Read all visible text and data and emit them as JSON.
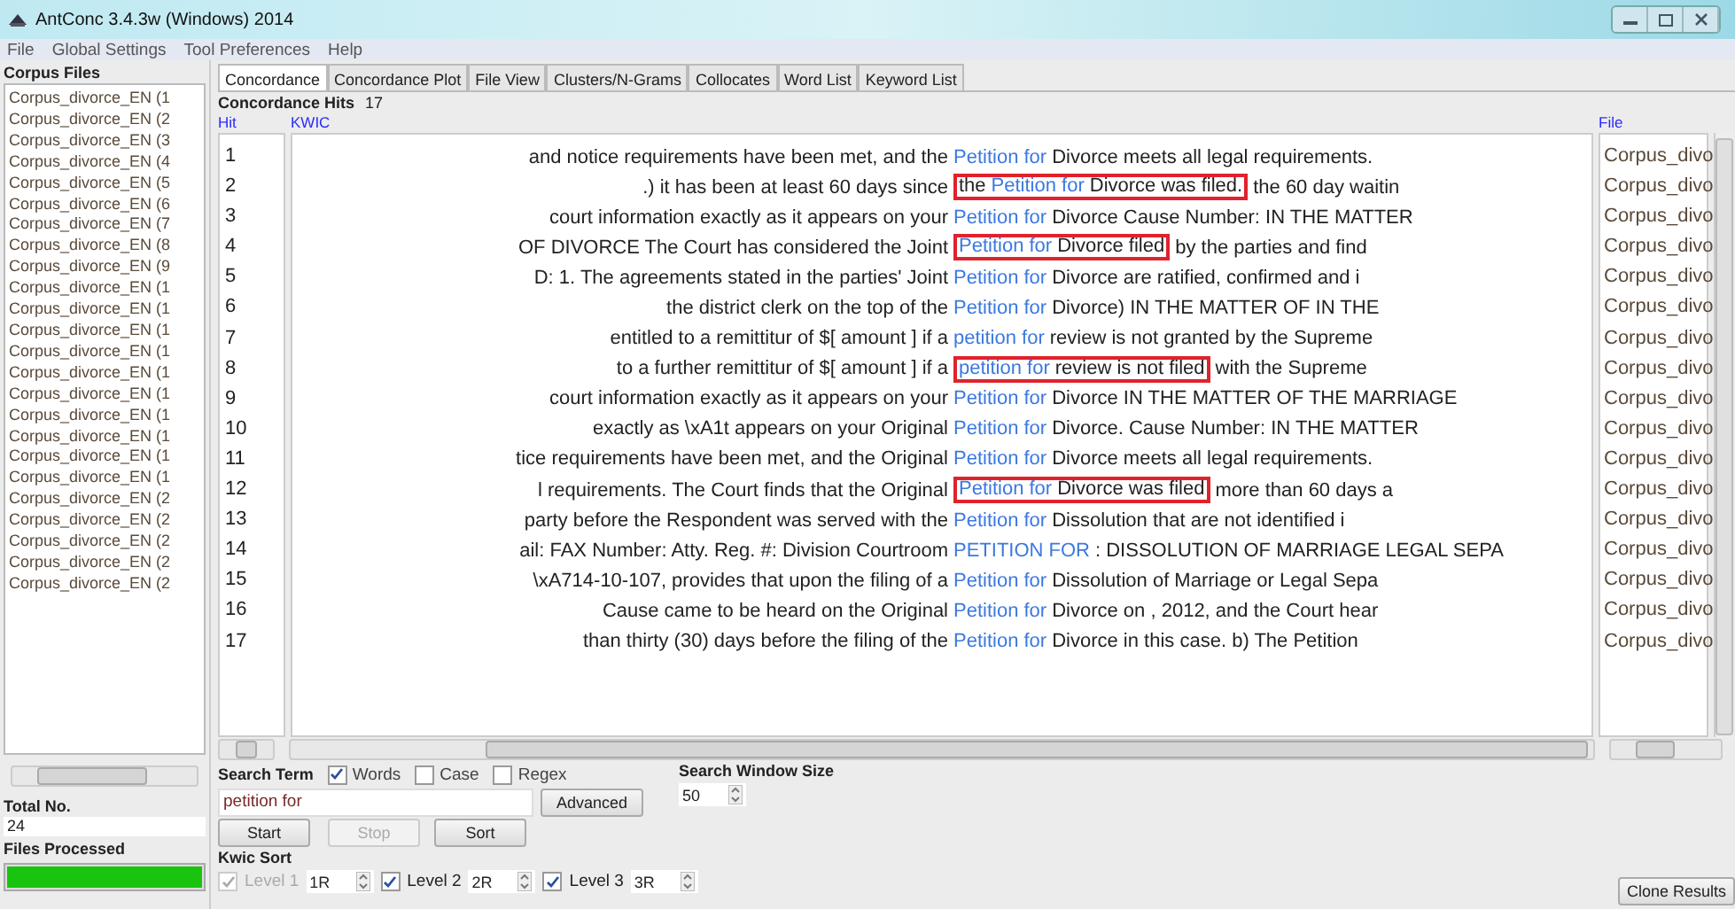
{
  "window": {
    "title": "AntConc 3.4.3w (Windows) 2014"
  },
  "menu": [
    "File",
    "Global Settings",
    "Tool Preferences",
    "Help"
  ],
  "corpus_files": {
    "title": "Corpus Files",
    "items": [
      "Corpus_divorce_EN (1",
      "Corpus_divorce_EN (2",
      "Corpus_divorce_EN (3",
      "Corpus_divorce_EN (4",
      "Corpus_divorce_EN (5",
      "Corpus_divorce_EN (6",
      "Corpus_divorce_EN (7",
      "Corpus_divorce_EN (8",
      "Corpus_divorce_EN (9",
      "Corpus_divorce_EN (1",
      "Corpus_divorce_EN (1",
      "Corpus_divorce_EN (1",
      "Corpus_divorce_EN (1",
      "Corpus_divorce_EN (1",
      "Corpus_divorce_EN (1",
      "Corpus_divorce_EN (1",
      "Corpus_divorce_EN (1",
      "Corpus_divorce_EN (1",
      "Corpus_divorce_EN (1",
      "Corpus_divorce_EN (2",
      "Corpus_divorce_EN (2",
      "Corpus_divorce_EN (2",
      "Corpus_divorce_EN (2",
      "Corpus_divorce_EN (2"
    ],
    "total_label": "Total No.",
    "total_value": "24",
    "processed_label": "Files Processed",
    "progress": {
      "level": 1.0
    }
  },
  "tabs": [
    {
      "label": "Concordance",
      "selected": true
    },
    {
      "label": "Concordance Plot",
      "selected": false
    },
    {
      "label": "File View",
      "selected": false
    },
    {
      "label": "Clusters/N-Grams",
      "selected": false
    },
    {
      "label": "Collocates",
      "selected": false
    },
    {
      "label": "Word List",
      "selected": false
    },
    {
      "label": "Keyword List",
      "selected": false
    }
  ],
  "hits": {
    "label": "Concordance Hits",
    "value": "17"
  },
  "table": {
    "columns": [
      "Hit",
      "KWIC",
      "File"
    ],
    "rows": [
      {
        "hit": "1",
        "left": "and notice requirements have been met, and the",
        "node": "Petition for",
        "right": "Divorce meets all legal requirements.",
        "file": "Corpus_divo",
        "boxed": false
      },
      {
        "hit": "2",
        "left": ".)  it has been at least 60 days since",
        "boxed_left": "the",
        "node": "Petition for",
        "boxed_right": "Divorce was filed.",
        "right": "the 60 day waitin",
        "file": "Corpus_divo",
        "boxed": true
      },
      {
        "hit": "3",
        "left": "court information exactly as it appears on your",
        "node": "Petition for",
        "right": "Divorce  Cause Number:  IN THE MATTER",
        "file": "Corpus_divo",
        "boxed": false
      },
      {
        "hit": "4",
        "left": "OF DIVORCE The Court has considered the Joint",
        "node": "Petition for",
        "boxed_right": "Divorce filed",
        "right": "by the parties and find",
        "file": "Corpus_divo",
        "boxed": true
      },
      {
        "hit": "5",
        "left": "D: 1. The agreements stated in the parties' Joint",
        "node": "Petition for",
        "right": "Divorce are ratified, confirmed and i",
        "file": "Corpus_divo",
        "boxed": false
      },
      {
        "hit": "6",
        "left": "the district clerk on the top of the",
        "node": "Petition for",
        "right": "Divorce) IN THE MATTER OF  IN THE",
        "file": "Corpus_divo",
        "boxed": false
      },
      {
        "hit": "7",
        "left": "entitled to a remittitur of $[ amount ] if a",
        "node": "petition for",
        "right": "review is not granted by the Supreme",
        "file": "Corpus_divo",
        "boxed": false
      },
      {
        "hit": "8",
        "left": "to a further remittitur of $[ amount ] if a",
        "node": "petition for",
        "boxed_right": "review is not filed",
        "right": "with the Supreme",
        "file": "Corpus_divo",
        "boxed": true
      },
      {
        "hit": "9",
        "left": "court information exactly as it appears on your",
        "node": "Petition for",
        "right": "Divorce IN THE MATTER OF THE MARRIAGE",
        "file": "Corpus_divo",
        "boxed": false
      },
      {
        "hit": "10",
        "left": "exactly as \\xA1t appears on your Original",
        "node": "Petition for",
        "right": "Divorce. Cause Number:  IN THE MATTER",
        "file": "Corpus_divo",
        "boxed": false
      },
      {
        "hit": "11",
        "left": "tice requirements have been met, and the Original",
        "node": "Petition for",
        "right": "Divorce meets all legal requirements.",
        "file": "Corpus_divo",
        "boxed": false
      },
      {
        "hit": "12",
        "left": "l requirements. The Court finds that the Original",
        "node": "Petition for",
        "boxed_right": "Divorce was filed",
        "right": "more than 60 days a",
        "file": "Corpus_divo",
        "boxed": true
      },
      {
        "hit": "13",
        "left": "party before the Respondent was served with the",
        "node": "Petition for",
        "right": "Dissolution that are not identified i",
        "file": "Corpus_divo",
        "boxed": false
      },
      {
        "hit": "14",
        "left": "ail: FAX Number: Atty. Reg. #: Division Courtroom",
        "node": "PETITION FOR",
        "right": ":  DISSOLUTION OF MARRIAGE  LEGAL SEPA",
        "file": "Corpus_divo",
        "boxed": false
      },
      {
        "hit": "15",
        "left": "\\xA714-10-107, provides that upon the filing of a",
        "node": "Petition for",
        "right": "Dissolution of Marriage or Legal Sepa",
        "file": "Corpus_divo",
        "boxed": false
      },
      {
        "hit": "16",
        "left": "Cause came to be heard on the Original",
        "node": "Petition for",
        "right": "Divorce on , 2012, and the Court hear",
        "file": "Corpus_divo",
        "boxed": false
      },
      {
        "hit": "17",
        "left": "than thirty (30) days before the filing of the",
        "node": "Petition for",
        "right": "Divorce in this case. b) The Petition",
        "file": "Corpus_divo",
        "boxed": false
      }
    ]
  },
  "search": {
    "label": "Search Term",
    "options": [
      {
        "label": "Words",
        "checked": true
      },
      {
        "label": "Case",
        "checked": false
      },
      {
        "label": "Regex",
        "checked": false
      }
    ],
    "value": "petition for",
    "advanced": "Advanced",
    "window_label": "Search Window Size",
    "window_value": "50"
  },
  "buttons": [
    {
      "label": "Start",
      "disabled": false
    },
    {
      "label": "Stop",
      "disabled": true
    },
    {
      "label": "Sort",
      "disabled": false
    }
  ],
  "kwic_sort": {
    "label": "Kwic Sort",
    "levels": [
      {
        "label": "Level 1",
        "value": "1R",
        "checked": true,
        "disabled": true
      },
      {
        "label": "Level 2",
        "value": "2R",
        "checked": true,
        "disabled": false
      },
      {
        "label": "Level 3",
        "value": "3R",
        "checked": true,
        "disabled": false
      }
    ]
  },
  "clone_button": "Clone Results"
}
